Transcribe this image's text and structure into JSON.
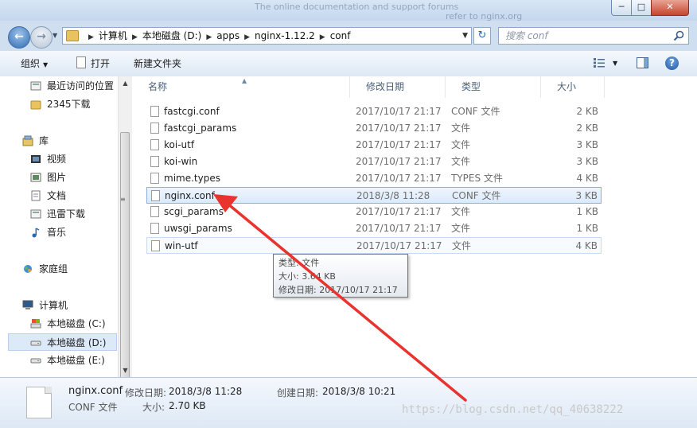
{
  "window": {
    "background_text": "The online documentation and support forums",
    "background_text2": "refer to nginx.org"
  },
  "nav": {
    "breadcrumbs": [
      "计算机",
      "本地磁盘 (D:)",
      "apps",
      "nginx-1.12.2",
      "conf"
    ],
    "search_placeholder": "搜索 conf"
  },
  "toolbar": {
    "organize": "组织",
    "open": "打开",
    "new_folder": "新建文件夹"
  },
  "sidebar": {
    "items": [
      {
        "label": "最近访问的位置",
        "icon": "recent-places-icon"
      },
      {
        "label": "2345下载",
        "icon": "folder-icon"
      },
      {
        "label": "库",
        "icon": "library-icon"
      },
      {
        "label": "视频",
        "icon": "video-icon"
      },
      {
        "label": "图片",
        "icon": "picture-icon"
      },
      {
        "label": "文档",
        "icon": "document-icon"
      },
      {
        "label": "迅雷下载",
        "icon": "download-icon"
      },
      {
        "label": "音乐",
        "icon": "music-icon"
      },
      {
        "label": "家庭组",
        "icon": "homegroup-icon"
      },
      {
        "label": "计算机",
        "icon": "computer-icon"
      },
      {
        "label": "本地磁盘 (C:)",
        "icon": "drive-c-icon"
      },
      {
        "label": "本地磁盘 (D:)",
        "icon": "drive-icon"
      },
      {
        "label": "本地磁盘 (E:)",
        "icon": "drive-icon"
      }
    ]
  },
  "columns": [
    "名称",
    "修改日期",
    "类型",
    "大小"
  ],
  "files": [
    {
      "name": "fastcgi.conf",
      "date": "2017/10/17 21:17",
      "type": "CONF 文件",
      "size": "2 KB"
    },
    {
      "name": "fastcgi_params",
      "date": "2017/10/17 21:17",
      "type": "文件",
      "size": "2 KB"
    },
    {
      "name": "koi-utf",
      "date": "2017/10/17 21:17",
      "type": "文件",
      "size": "3 KB"
    },
    {
      "name": "koi-win",
      "date": "2017/10/17 21:17",
      "type": "文件",
      "size": "3 KB"
    },
    {
      "name": "mime.types",
      "date": "2017/10/17 21:17",
      "type": "TYPES 文件",
      "size": "4 KB"
    },
    {
      "name": "nginx.conf",
      "date": "2018/3/8 11:28",
      "type": "CONF 文件",
      "size": "3 KB"
    },
    {
      "name": "scgi_params",
      "date": "2017/10/17 21:17",
      "type": "文件",
      "size": "1 KB"
    },
    {
      "name": "uwsgi_params",
      "date": "2017/10/17 21:17",
      "type": "文件",
      "size": "1 KB"
    },
    {
      "name": "win-utf",
      "date": "2017/10/17 21:17",
      "type": "文件",
      "size": "4 KB"
    }
  ],
  "tooltip": {
    "type": "类型: 文件",
    "size": "大小: 3.64 KB",
    "modified": "修改日期: 2017/10/17 21:17"
  },
  "details": {
    "name": "nginx.conf",
    "modified_label": "修改日期:",
    "modified": "2018/3/8 11:28",
    "created_label": "创建日期:",
    "created": "2018/3/8 10:21",
    "type": "CONF 文件",
    "size_label": "大小:",
    "size": "2.70 KB"
  },
  "watermark": "https://blog.csdn.net/qq_40638222",
  "colors": {
    "selection_bg": "#dbeafc",
    "selection_border": "#89b1e0",
    "annotation_arrow": "#e8332e"
  }
}
